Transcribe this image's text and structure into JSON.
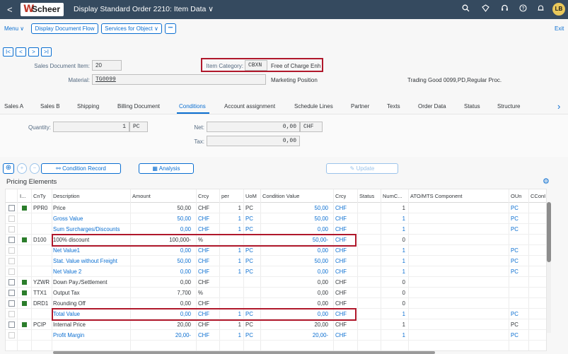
{
  "shell": {
    "back_icon": "<",
    "logo_mark": "W",
    "logo_text": "Scheer",
    "title": "Display Standard Order 2210: Item Data",
    "title_caret": "∨",
    "avatar": "LB"
  },
  "toolbar": {
    "menu": "Menu",
    "menu_caret": "∨",
    "display_doc_flow": "Display Document Flow",
    "services": "Services for Object ∨",
    "more": "•••",
    "exit": "Exit"
  },
  "nav_buttons": [
    "I<",
    "<",
    ">",
    ">I"
  ],
  "header": {
    "sales_doc_item_label": "Sales Document Item:",
    "sales_doc_item_value": "20",
    "item_category_label": "Item Category:",
    "item_category_value": "CBXN",
    "item_category_desc": "Free of Charge Enh",
    "material_label": "Material:",
    "material_value": "TG0099",
    "marketing_position": "Marketing Position",
    "material_desc": "Trading Good 0099,PD,Regular Proc."
  },
  "tabs": [
    "Sales A",
    "Sales B",
    "Shipping",
    "Billing Document",
    "Conditions",
    "Account assignment",
    "Schedule Lines",
    "Partner",
    "Texts",
    "Order Data",
    "Status",
    "Structure"
  ],
  "tabs_more": "›",
  "summary": {
    "quantity_label": "Quantity:",
    "quantity_value": "1",
    "quantity_unit": "PC",
    "net_label": "Net:",
    "net_value": "0,00",
    "net_currency": "CHF",
    "tax_label": "Tax:",
    "tax_value": "0,00"
  },
  "pricing_toolbar": {
    "zoom_icon": "⊕",
    "add_icon": "+",
    "remove_icon": "−",
    "condition_record": "Condition Record",
    "condition_record_icon": "⚯",
    "analysis": "Analysis",
    "analysis_icon": "▦",
    "update": "Update",
    "update_icon": "✎"
  },
  "pricing": {
    "title": "Pricing Elements",
    "settings_icon": "⚙",
    "columns": [
      "I...",
      "CnTy",
      "Description",
      "Amount",
      "Crcy",
      "per",
      "UoM",
      "Condition Value",
      "Crcy",
      "Status",
      "NumC...",
      "ATO/MTS Component",
      "OUn",
      "CConI"
    ],
    "rows": [
      {
        "check": true,
        "green": true,
        "cnty": "PPR0",
        "desc": "Price",
        "amount": "50,00",
        "crcy": "CHF",
        "per": "1",
        "uom": "PC",
        "cval": "50,00",
        "ccrcy": "CHF",
        "numc": "1",
        "oun": "PC",
        "blue": false
      },
      {
        "check": false,
        "green": false,
        "cnty": "",
        "desc": "Gross Value",
        "amount": "50,00",
        "crcy": "CHF",
        "per": "1",
        "uom": "PC",
        "cval": "50,00",
        "ccrcy": "CHF",
        "numc": "1",
        "oun": "PC",
        "blue": true
      },
      {
        "check": false,
        "green": false,
        "cnty": "",
        "desc": "Sum Surcharges/Discounts",
        "amount": "0,00",
        "crcy": "CHF",
        "per": "1",
        "uom": "PC",
        "cval": "0,00",
        "ccrcy": "CHF",
        "numc": "1",
        "oun": "PC",
        "blue": true
      },
      {
        "check": true,
        "green": true,
        "cnty": "D100",
        "desc": "100% discount",
        "amount": "100,000-",
        "crcy": "%",
        "per": "",
        "uom": "",
        "cval": "50,00-",
        "ccrcy": "CHF",
        "numc": "0",
        "oun": "",
        "blue": false
      },
      {
        "check": false,
        "green": false,
        "cnty": "",
        "desc": "Net Value1",
        "amount": "0,00",
        "crcy": "CHF",
        "per": "1",
        "uom": "PC",
        "cval": "0,00",
        "ccrcy": "CHF",
        "numc": "1",
        "oun": "PC",
        "blue": true
      },
      {
        "check": false,
        "green": false,
        "cnty": "",
        "desc": "Stat. Value without Freight",
        "amount": "50,00",
        "crcy": "CHF",
        "per": "1",
        "uom": "PC",
        "cval": "50,00",
        "ccrcy": "CHF",
        "numc": "1",
        "oun": "PC",
        "blue": true
      },
      {
        "check": false,
        "green": false,
        "cnty": "",
        "desc": "Net Value 2",
        "amount": "0,00",
        "crcy": "CHF",
        "per": "1",
        "uom": "PC",
        "cval": "0,00",
        "ccrcy": "CHF",
        "numc": "1",
        "oun": "PC",
        "blue": true
      },
      {
        "check": true,
        "green": true,
        "cnty": "YZWR",
        "desc": "Down Pay./Settlement",
        "amount": "0,00",
        "crcy": "CHF",
        "per": "",
        "uom": "",
        "cval": "0,00",
        "ccrcy": "CHF",
        "numc": "0",
        "oun": "",
        "blue": false
      },
      {
        "check": true,
        "green": true,
        "cnty": "TTX1",
        "desc": "Output Tax",
        "amount": "7,700",
        "crcy": "%",
        "per": "",
        "uom": "",
        "cval": "0,00",
        "ccrcy": "CHF",
        "numc": "0",
        "oun": "",
        "blue": false
      },
      {
        "check": true,
        "green": true,
        "cnty": "DRD1",
        "desc": "Rounding Off",
        "amount": "0,00",
        "crcy": "CHF",
        "per": "",
        "uom": "",
        "cval": "0,00",
        "ccrcy": "CHF",
        "numc": "0",
        "oun": "",
        "blue": false
      },
      {
        "check": false,
        "green": false,
        "cnty": "",
        "desc": "Total Value",
        "amount": "0,00",
        "crcy": "CHF",
        "per": "1",
        "uom": "PC",
        "cval": "0,00",
        "ccrcy": "CHF",
        "numc": "1",
        "oun": "PC",
        "blue": true
      },
      {
        "check": true,
        "green": true,
        "cnty": "PCIP",
        "desc": "Internal Price",
        "amount": "20,00",
        "crcy": "CHF",
        "per": "1",
        "uom": "PC",
        "cval": "20,00",
        "ccrcy": "CHF",
        "numc": "1",
        "oun": "PC",
        "blue": false
      },
      {
        "check": false,
        "green": false,
        "cnty": "",
        "desc": "Profit Margin",
        "amount": "20,00-",
        "crcy": "CHF",
        "per": "1",
        "uom": "PC",
        "cval": "20,00-",
        "ccrcy": "CHF",
        "numc": "1",
        "oun": "PC",
        "blue": true
      }
    ]
  },
  "colors": {
    "shell": "#354a5f",
    "accent": "#0a6ed1",
    "highlight": "#b0182b",
    "status_green": "#2b7d2b"
  }
}
